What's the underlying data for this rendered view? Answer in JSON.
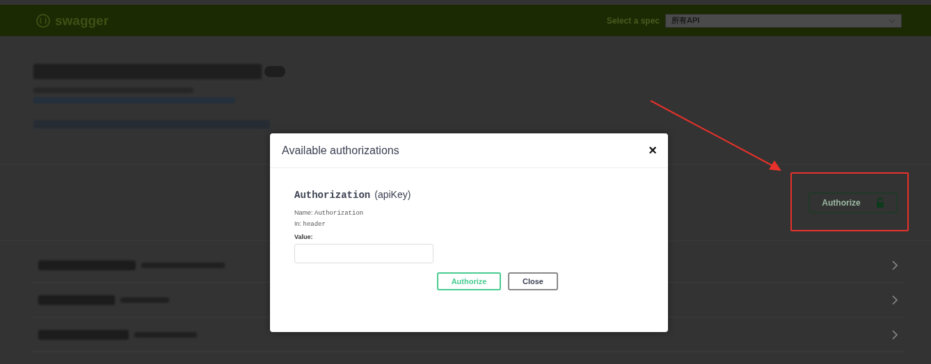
{
  "header": {
    "logo": "swagger",
    "spec_label": "Select a spec",
    "spec_value": "所有API"
  },
  "authorize_button": {
    "label": "Authorize",
    "locked": false
  },
  "operations": [
    {
      "expanded": false
    },
    {
      "expanded": false
    },
    {
      "expanded": false
    }
  ],
  "modal": {
    "title": "Available authorizations",
    "close_glyph": "×",
    "scheme_name": "Authorization",
    "scheme_type": "(apiKey)",
    "name_label": "Name:",
    "name_value": "Authorization",
    "in_label": "In:",
    "in_value": "header",
    "value_label": "Value:",
    "buttons": [
      {
        "label": "Authorize",
        "kind": "primary"
      },
      {
        "label": "Close",
        "kind": "secondary"
      }
    ]
  }
}
